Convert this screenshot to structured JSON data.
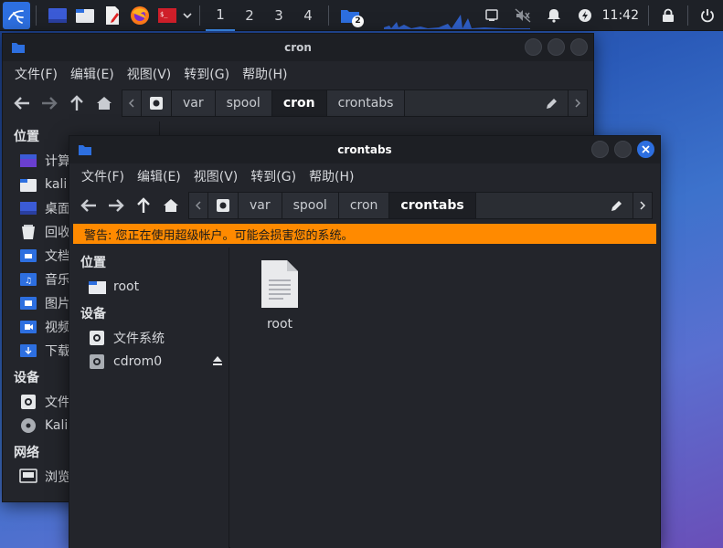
{
  "panel": {
    "workspaces": [
      "1",
      "2",
      "3",
      "4"
    ],
    "notification_count": "2",
    "clock": "11:42"
  },
  "back_window": {
    "title": "cron",
    "menu": [
      "文件(F)",
      "编辑(E)",
      "视图(V)",
      "转到(G)",
      "帮助(H)"
    ],
    "path": [
      "var",
      "spool",
      "cron",
      "crontabs"
    ],
    "current": "cron",
    "sidebar": {
      "places_title": "位置",
      "places": [
        "计算",
        "kali",
        "桌面",
        "回收",
        "文档",
        "音乐",
        "图片",
        "视频",
        "下载"
      ],
      "devices_title": "设备",
      "devices": [
        "文件",
        "Kali"
      ],
      "network_title": "网络",
      "network": [
        "浏览"
      ]
    }
  },
  "front_window": {
    "title": "crontabs",
    "menu": [
      "文件(F)",
      "编辑(E)",
      "视图(V)",
      "转到(G)",
      "帮助(H)"
    ],
    "path": [
      "var",
      "spool",
      "cron",
      "crontabs"
    ],
    "current": "crontabs",
    "warning": "警告: 您正在使用超级帐户。可能会损害您的系统。",
    "sidebar": {
      "places_title": "位置",
      "places": [
        "root"
      ],
      "devices_title": "设备",
      "devices": [
        "文件系统",
        "cdrom0"
      ]
    },
    "files": [
      {
        "name": "root"
      }
    ]
  },
  "colors": {
    "accent": "#2d6fe0",
    "warning_bg": "#ff8a00",
    "window_bg": "#23252b"
  }
}
